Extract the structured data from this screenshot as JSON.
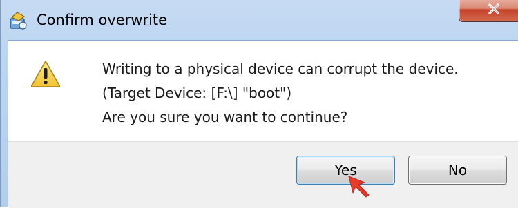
{
  "window": {
    "title": "Confirm overwrite",
    "app_icon": "app-icon",
    "close_label": "x"
  },
  "dialog": {
    "icon": "warning-icon",
    "message_lines": [
      "Writing to a physical device can corrupt the device.",
      "(Target Device: [F:\\] \"boot\")",
      "Are you sure you want to continue?"
    ],
    "buttons": {
      "yes_label": "Yes",
      "no_label": "No"
    }
  },
  "colors": {
    "warning_fill": "#f7d345",
    "close_button": "#c5412a",
    "cursor_annotation": "#e83a2a"
  }
}
